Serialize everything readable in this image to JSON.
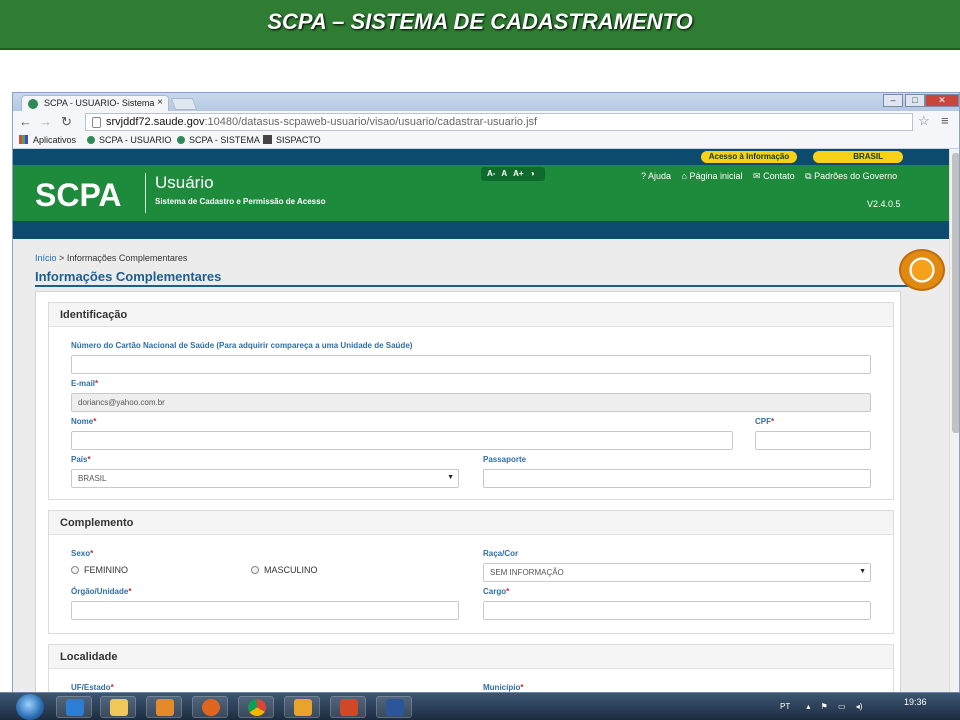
{
  "slide": {
    "title": "SCPA – SISTEMA DE CADASTRAMENTO"
  },
  "browser": {
    "tab_title": "SCPA - USUARIO- Sistema",
    "tab_close": "×",
    "url_host": "srvjddf72.saude.gov",
    "url_path": ":10480/datasus-scpaweb-usuario/visao/usuario/cadastrar-usuario.jsf",
    "bookmarks": [
      "Aplicativos",
      "SCPA - USUARIO",
      "SCPA - SISTEMA",
      "SISPACTO"
    ]
  },
  "gov": {
    "acesso": "Acesso à Informação",
    "brasil": "BRASIL"
  },
  "header": {
    "logo": "SCPA",
    "app_name": "Usuário",
    "subtitle": "Sistema de Cadastro e Permissão de Acesso",
    "font_controls": [
      "A-",
      "A",
      "A+",
      "◑"
    ],
    "links": [
      "? Ajuda",
      "⌂ Página inicial",
      "✉ Contato",
      "⧉ Padrões do Governo"
    ],
    "version": "V2.4.0.5"
  },
  "breadcrumb": {
    "home": "Início",
    "sep": ">",
    "current": "Informações Complementares"
  },
  "page_title": "Informações Complementares",
  "identificacao": {
    "title": "Identificação",
    "cns_label": "Número do Cartão Nacional de Saúde (Para adquirir compareça a uma Unidade de Saúde)",
    "cns_value": "",
    "email_label": "E-mail",
    "email_value": "doriancs@yahoo.com.br",
    "nome_label": "Nome",
    "cpf_label": "CPF",
    "pais_label": "País",
    "pais_value": "BRASIL",
    "passaporte_label": "Passaporte"
  },
  "complemento": {
    "title": "Complemento",
    "sexo_label": "Sexo",
    "sexo_options": [
      "FEMININO",
      "MASCULINO"
    ],
    "raca_label": "Raça/Cor",
    "raca_value": "SEM INFORMAÇÃO",
    "orgao_label": "Órgão/Unidade",
    "cargo_label": "Cargo"
  },
  "localidade": {
    "title": "Localidade",
    "uf_label": "UF/Estado",
    "municipio_label": "Município"
  },
  "required_mark": "*",
  "taskbar": {
    "lang": "PT",
    "clock": "19:36"
  }
}
